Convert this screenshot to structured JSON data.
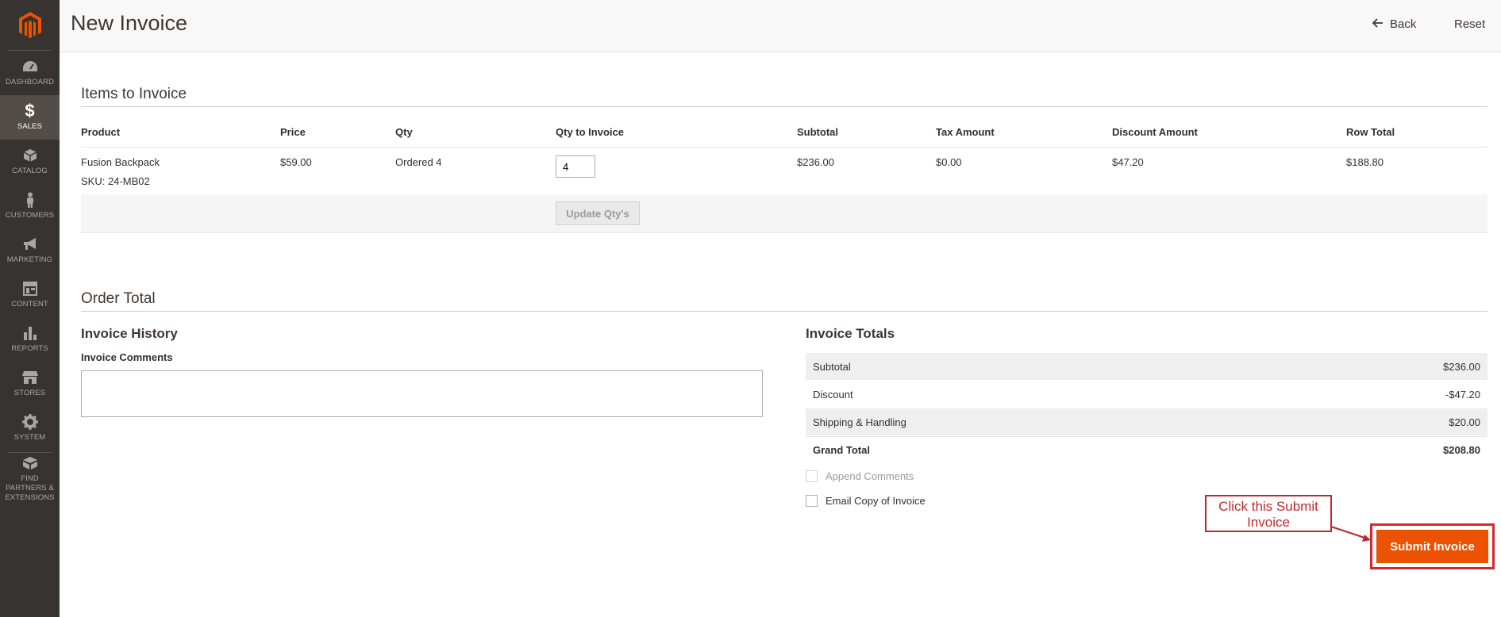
{
  "sidebar": {
    "items": [
      {
        "label": "DASHBOARD",
        "icon": "dashboard-icon"
      },
      {
        "label": "SALES",
        "icon": "dollar-icon"
      },
      {
        "label": "CATALOG",
        "icon": "cube-icon"
      },
      {
        "label": "CUSTOMERS",
        "icon": "person-icon"
      },
      {
        "label": "MARKETING",
        "icon": "megaphone-icon"
      },
      {
        "label": "CONTENT",
        "icon": "layout-icon"
      },
      {
        "label": "REPORTS",
        "icon": "bar-chart-icon"
      },
      {
        "label": "STORES",
        "icon": "store-icon"
      },
      {
        "label": "SYSTEM",
        "icon": "gear-icon"
      },
      {
        "label": "FIND PARTNERS & EXTENSIONS",
        "icon": "box-icon"
      }
    ]
  },
  "header": {
    "title": "New Invoice",
    "back_label": "Back",
    "reset_label": "Reset"
  },
  "items_section": {
    "title": "Items to Invoice",
    "columns": [
      "Product",
      "Price",
      "Qty",
      "Qty to Invoice",
      "Subtotal",
      "Tax Amount",
      "Discount Amount",
      "Row Total"
    ],
    "row": {
      "product": "Fusion Backpack",
      "sku": "SKU: 24-MB02",
      "price": "$59.00",
      "qty": "Ordered 4",
      "qty_to_invoice": "4",
      "subtotal": "$236.00",
      "tax": "$0.00",
      "discount": "$47.20",
      "row_total": "$188.80"
    },
    "update_label": "Update Qty's"
  },
  "order_total": {
    "title": "Order Total",
    "history_title": "Invoice History",
    "comments_label": "Invoice Comments",
    "totals_title": "Invoice Totals",
    "totals": [
      {
        "label": "Subtotal",
        "value": "$236.00"
      },
      {
        "label": "Discount",
        "value": "-$47.20"
      },
      {
        "label": "Shipping & Handling",
        "value": "$20.00"
      },
      {
        "label": "Grand Total",
        "value": "$208.80"
      }
    ],
    "append_comments_label": "Append Comments",
    "email_copy_label": "Email Copy of Invoice",
    "submit_label": "Submit Invoice"
  },
  "annotation": {
    "callout_text": "Click this Submit Invoice"
  },
  "colors": {
    "sidebar_bg": "#373330",
    "accent": "#eb5202",
    "annotation_red": "#c0282d"
  }
}
